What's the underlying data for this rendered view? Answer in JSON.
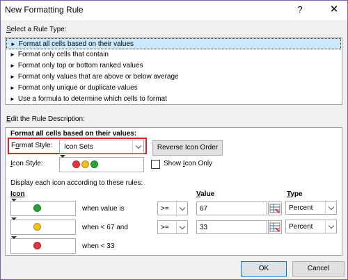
{
  "window": {
    "title": "New Formatting Rule",
    "help": "?",
    "close": "✕"
  },
  "select_rule_type": {
    "label_prefix": "",
    "label_accel": "S",
    "label_rest": "elect a Rule Type:",
    "items": [
      {
        "label": "Format all cells based on their values",
        "selected": true
      },
      {
        "label": "Format only cells that contain",
        "selected": false
      },
      {
        "label": "Format only top or bottom ranked values",
        "selected": false
      },
      {
        "label": "Format only values that are above or below average",
        "selected": false
      },
      {
        "label": "Format only unique or duplicate values",
        "selected": false
      },
      {
        "label": "Use a formula to determine which cells to format",
        "selected": false
      }
    ],
    "arrow": "►"
  },
  "edit_rule": {
    "label_prefix": "",
    "label_accel": "E",
    "label_rest": "dit the Rule Description:",
    "heading": "Format all cells based on their values:",
    "format_style_prefix": "F",
    "format_style_accel": "o",
    "format_style_rest": "rmat Style:",
    "format_style_value": "Icon Sets",
    "reverse_button": "Reverse Icon Order",
    "icon_style_accel": "I",
    "icon_style_rest": "con Style:",
    "show_icon_only_prefix": "Show ",
    "show_icon_only_accel": "I",
    "show_icon_only_rest": "con Only",
    "show_icon_only_checked": false,
    "rules_caption": "Display each icon according to these rules:",
    "col_icon": "Icon",
    "col_value_accel": "V",
    "col_value_rest": "alue",
    "col_type_accel": "T",
    "col_type_rest": "ype",
    "rows": [
      {
        "icon_color": "#27a23a",
        "condition": "when value is",
        "operator": ">=",
        "value": "67",
        "type": "Percent"
      },
      {
        "icon_color": "#f2c01d",
        "condition": "when < 67 and",
        "operator": ">=",
        "value": "33",
        "type": "Percent"
      },
      {
        "icon_color": "#e3353a",
        "condition": "when < 33",
        "operator": "",
        "value": "",
        "type": ""
      }
    ]
  },
  "footer": {
    "ok": "OK",
    "cancel": "Cancel"
  },
  "colors": {
    "selection": "#cce8ff",
    "highlight_border": "#e0202a",
    "window_border": "#7a5fb0",
    "green": "#27a23a",
    "yellow": "#f2c01d",
    "red": "#e3353a"
  },
  "icon_style_preview": [
    "#e3353a",
    "#f2c01d",
    "#27a23a"
  ]
}
